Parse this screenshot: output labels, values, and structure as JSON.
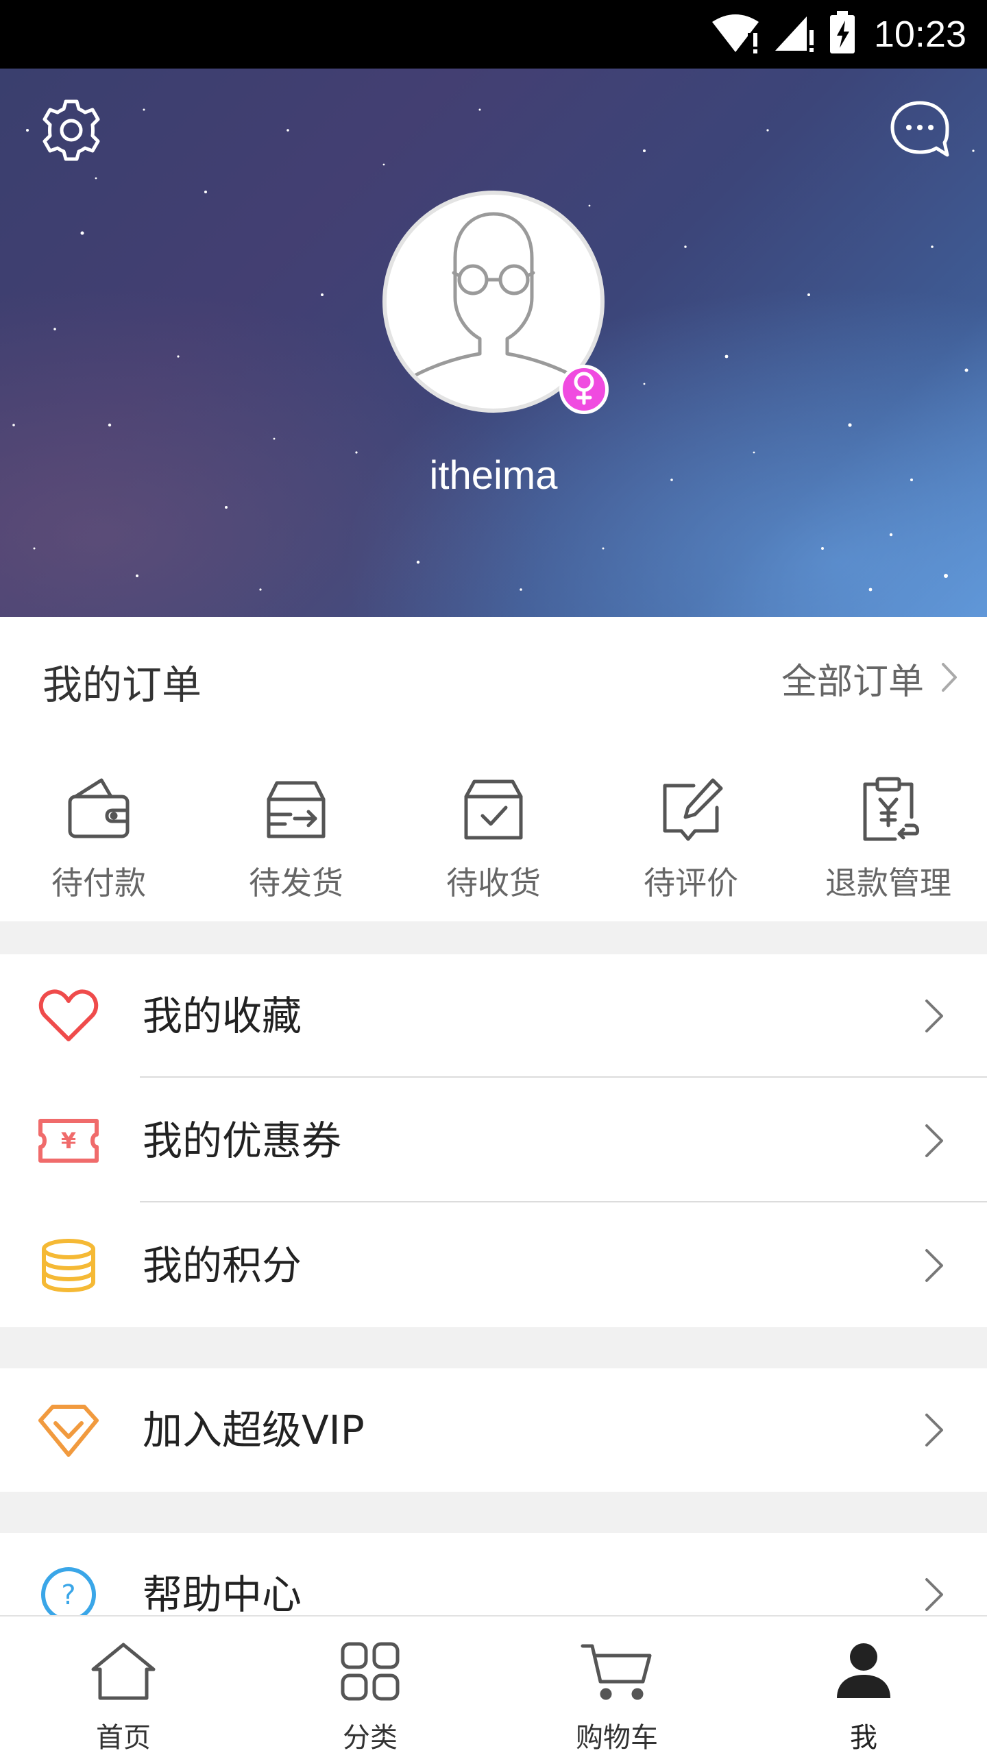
{
  "status_bar": {
    "time": "10:23"
  },
  "header": {
    "username": "itheima",
    "gender_symbol": "♀"
  },
  "orders": {
    "title": "我的订单",
    "all_orders_label": "全部订单",
    "items": [
      {
        "label": "待付款",
        "icon": "wallet-icon"
      },
      {
        "label": "待发货",
        "icon": "shipping-box-icon"
      },
      {
        "label": "待收货",
        "icon": "received-box-icon"
      },
      {
        "label": "待评价",
        "icon": "review-edit-icon"
      },
      {
        "label": "退款管理",
        "icon": "refund-clipboard-icon"
      }
    ]
  },
  "menu": {
    "favorites": {
      "label": "我的收藏",
      "icon": "heart-icon",
      "color": "#ef4b4b"
    },
    "coupons": {
      "label": "我的优惠券",
      "icon": "coupon-icon",
      "color": "#f06b6b",
      "symbol": "¥"
    },
    "points": {
      "label": "我的积分",
      "icon": "coins-icon",
      "color": "#f5b935"
    },
    "vip": {
      "label": "加入超级VIP",
      "icon": "diamond-icon",
      "color": "#f19a3e"
    },
    "help": {
      "label": "帮助中心",
      "icon": "help-icon",
      "color": "#3aa6e8",
      "symbol": "?"
    }
  },
  "tab_bar": {
    "items": [
      {
        "label": "首页",
        "icon": "home-icon"
      },
      {
        "label": "分类",
        "icon": "category-grid-icon"
      },
      {
        "label": "购物车",
        "icon": "cart-icon"
      },
      {
        "label": "我",
        "icon": "person-icon",
        "active": true
      }
    ]
  }
}
